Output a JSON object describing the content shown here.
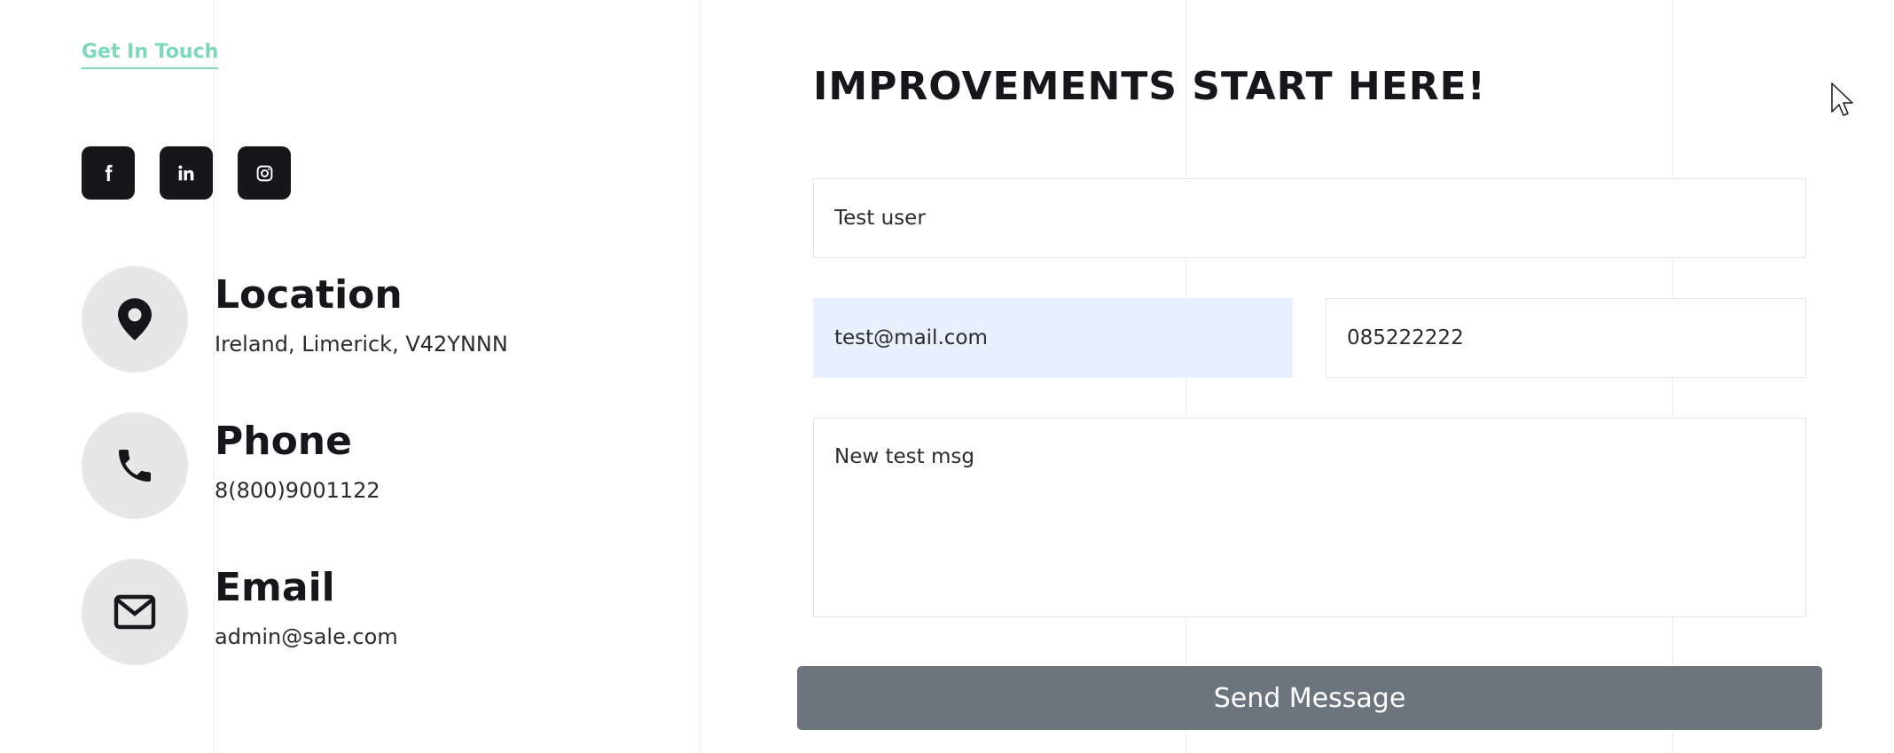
{
  "left": {
    "get_in_touch": "Get In Touch",
    "socials": [
      {
        "icon": "facebook-icon"
      },
      {
        "icon": "linkedin-icon"
      },
      {
        "icon": "instagram-icon"
      }
    ],
    "contacts": [
      {
        "icon": "location-pin-icon",
        "title": "Location",
        "value": "Ireland, Limerick, V42YNNN"
      },
      {
        "icon": "phone-icon",
        "title": "Phone",
        "value": "8(800)9001122"
      },
      {
        "icon": "envelope-icon",
        "title": "Email",
        "value": "admin@sale.com"
      }
    ]
  },
  "form": {
    "title": "IMPROVEMENTS START HERE!",
    "name_value": "Test user",
    "email_value": "test@mail.com",
    "phone_value": "085222222",
    "message_value": "New test msg",
    "send_label": "Send Message"
  },
  "colors": {
    "accent": "#7dd7b9",
    "button": "#6c757d",
    "dark": "#16161b",
    "autofill": "#e8f0fe"
  }
}
